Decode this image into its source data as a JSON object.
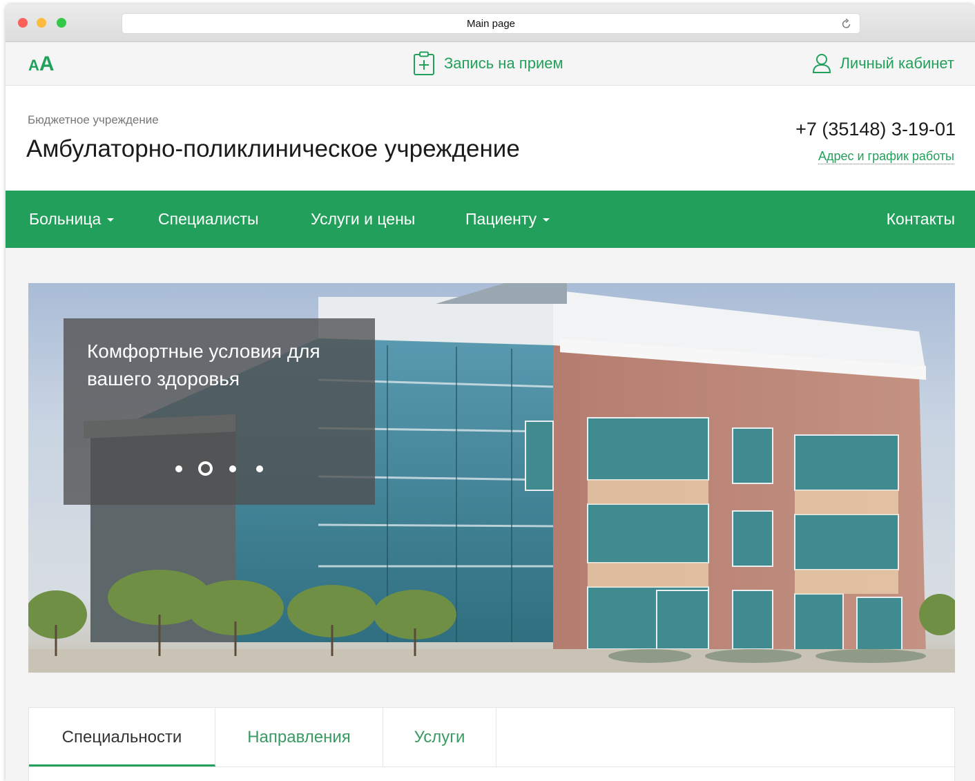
{
  "browser": {
    "page_title": "Main page"
  },
  "utility": {
    "font_small": "A",
    "font_big": "A",
    "appointment_label": "Запись на прием",
    "cabinet_label": "Личный кабинет"
  },
  "header": {
    "org_type": "Бюджетное учреждение",
    "org_name": "Амбулаторно-поликлиническое учреждение",
    "phone": "+7 (35148) 3-19-01",
    "address_link": "Адрес и график работы"
  },
  "nav": {
    "items": [
      {
        "label": "Больница",
        "dropdown": true
      },
      {
        "label": "Специалисты",
        "dropdown": false
      },
      {
        "label": "Услуги и цены",
        "dropdown": false
      },
      {
        "label": "Пациенту",
        "dropdown": true
      },
      {
        "label": "Контакты",
        "dropdown": false
      }
    ]
  },
  "hero": {
    "caption": "Комфортные условия для вашего здоровья",
    "slides_count": 4,
    "active_slide": 2
  },
  "tabs": {
    "items": [
      {
        "label": "Специальности",
        "active": true
      },
      {
        "label": "Направления",
        "active": false
      },
      {
        "label": "Услуги",
        "active": false
      }
    ]
  },
  "colors": {
    "brand_green": "#22a05b",
    "caption_overlay": "#505050"
  }
}
